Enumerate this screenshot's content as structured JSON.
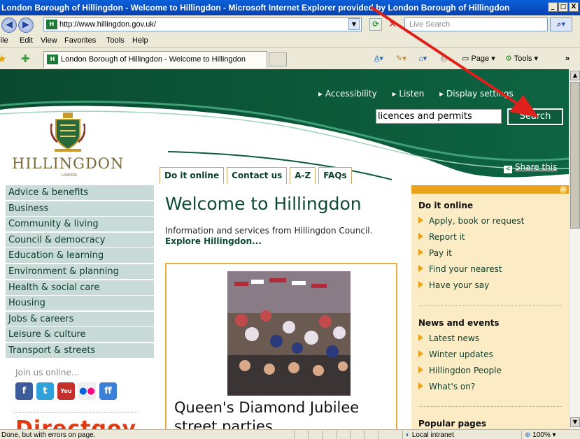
{
  "window": {
    "title": "London Borough of Hillingdon - Welcome to Hillingdon - Microsoft Internet Explorer provided by London Borough of Hillingdon",
    "buttons": [
      "_",
      "□",
      "X"
    ]
  },
  "address_bar": {
    "url": "http://www.hillingdon.gov.uk/",
    "live_search_placeholder": "Live Search"
  },
  "menu": [
    "File",
    "Edit",
    "View",
    "Favorites",
    "Tools",
    "Help"
  ],
  "tab": {
    "title": "London Borough of Hillingdon - Welcome to Hillingdon"
  },
  "command_bar": {
    "page_label": "Page",
    "tools_label": "Tools"
  },
  "site": {
    "top_links": [
      "Accessibility",
      "Listen",
      "Display settings"
    ],
    "search_value": "licences and permits",
    "search_button": "Search",
    "logo_text": "HILLINGDON",
    "logo_sub": "LONDON",
    "nav_tabs": [
      "Do it online",
      "Contact us",
      "A-Z",
      "FAQs"
    ],
    "share_label": "Share this"
  },
  "left_nav": [
    "Advice & benefits",
    "Business",
    "Community & living",
    "Council & democracy",
    "Education & learning",
    "Environment & planning",
    "Health & social care",
    "Housing",
    "Jobs & careers",
    "Leisure & culture",
    "Transport & streets"
  ],
  "join_us": "Join us online...",
  "social_icons": [
    "facebook-icon",
    "twitter-icon",
    "youtube-icon",
    "flickr-icon",
    "friendfeed-icon"
  ],
  "direct_gov": "Directgov",
  "main": {
    "heading": "Welcome to Hillingdon",
    "intro": "Information and services from Hillingdon Council.",
    "intro_link": "Explore Hillingdon...",
    "feature_title_line1": "Queen's Diamond Jubilee",
    "feature_title_line2": "street parties"
  },
  "right_panel": {
    "do_it_online": {
      "heading": "Do it online",
      "links": [
        "Apply, book or request",
        "Report it",
        "Pay it",
        "Find your nearest",
        "Have your say"
      ]
    },
    "news": {
      "heading": "News and events",
      "links": [
        "Latest news",
        "Winter updates",
        "Hillingdon People",
        "What's on?"
      ]
    },
    "popular": {
      "heading": "Popular pages"
    }
  },
  "status_bar": {
    "text": "Done, but with errors on page.",
    "zone": "Local intranet",
    "zoom": "100%"
  },
  "colors": {
    "site_green": "#0d5b3c",
    "accent_orange": "#e9a21a",
    "nav_bg": "#c9dbd8",
    "annotation_arrow": "#e0201a"
  }
}
